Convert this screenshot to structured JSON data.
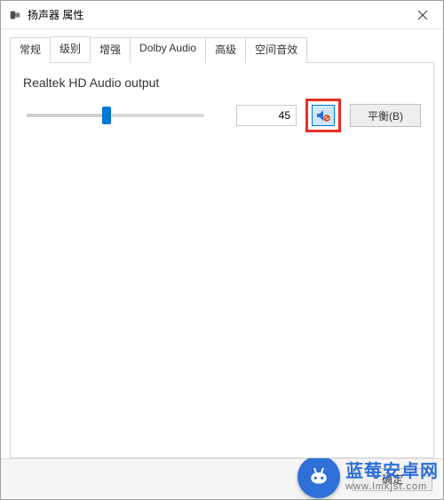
{
  "window": {
    "title": "扬声器 属性"
  },
  "tabs": {
    "items": [
      {
        "label": "常规"
      },
      {
        "label": "级别"
      },
      {
        "label": "增强"
      },
      {
        "label": "Dolby Audio"
      },
      {
        "label": "高级"
      },
      {
        "label": "空间音效"
      }
    ],
    "active_index": 1
  },
  "level": {
    "device_name": "Realtek HD Audio output",
    "value": "45",
    "balance_label": "平衡(B)"
  },
  "footer": {
    "ok_label": "确定"
  },
  "watermark": {
    "line1": "蓝莓安卓网",
    "line2": "www.lmkjst.com"
  }
}
